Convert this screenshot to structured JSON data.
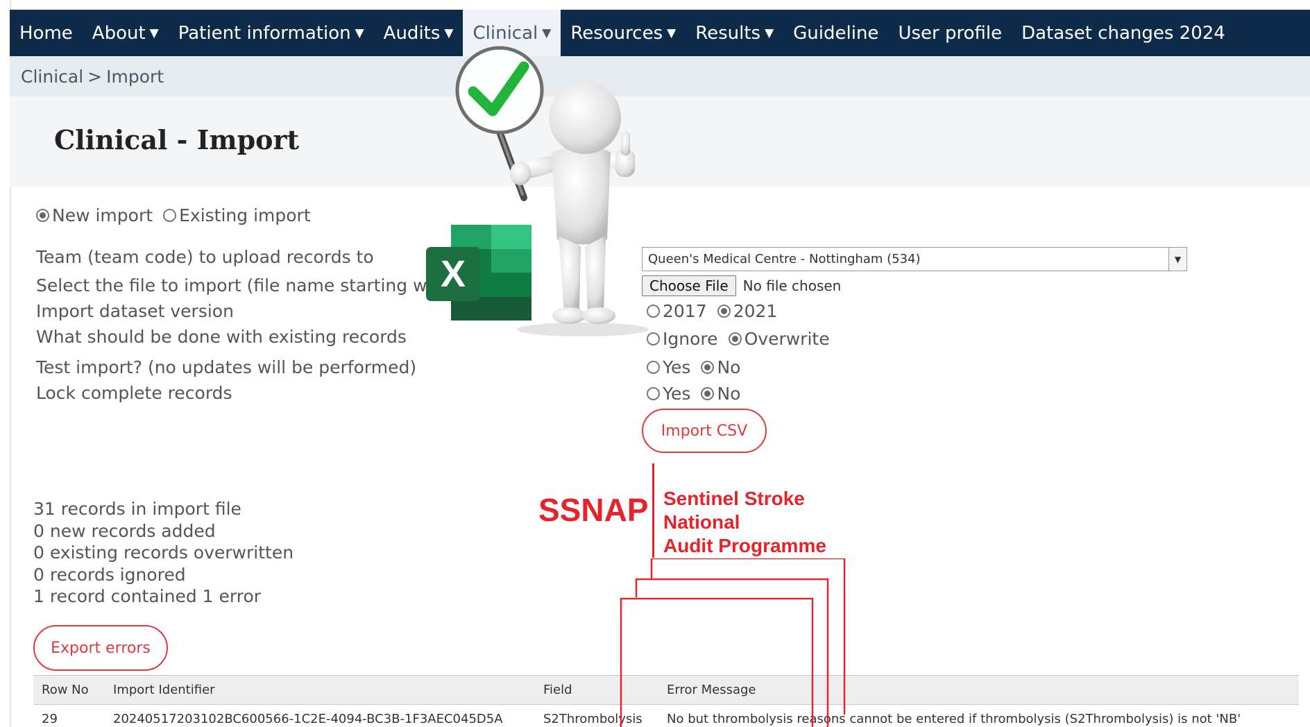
{
  "nav": {
    "items": [
      {
        "label": "Home",
        "dropdown": false
      },
      {
        "label": "About",
        "dropdown": true
      },
      {
        "label": "Patient information",
        "dropdown": true
      },
      {
        "label": "Audits",
        "dropdown": true
      },
      {
        "label": "Clinical",
        "dropdown": true,
        "active": true
      },
      {
        "label": "Resources",
        "dropdown": true
      },
      {
        "label": "Results",
        "dropdown": true
      },
      {
        "label": "Guideline",
        "dropdown": false
      },
      {
        "label": "User profile",
        "dropdown": false
      },
      {
        "label": "Dataset changes 2024",
        "dropdown": false
      }
    ],
    "caret": "▼"
  },
  "breadcrumb": {
    "parent": "Clinical",
    "separator": ">",
    "current": "Import"
  },
  "page": {
    "title": "Clinical - Import"
  },
  "mode": {
    "new_label": "New import",
    "existing_label": "Existing import",
    "selected": "New import"
  },
  "form": {
    "team_label": "Team (team code) to upload records to",
    "team_value": "Queen's Medical Centre - Nottingham (534)",
    "file_label": "Select the file to import (file name starting with t",
    "file_label_tail": ")",
    "file_button": "Choose File",
    "file_status": "No file chosen",
    "version_label": "Import dataset version",
    "version_options": [
      "2017",
      "2021"
    ],
    "version_selected": "2021",
    "existing_label": "What should be done with existing records",
    "existing_options": [
      "Ignore",
      "Overwrite"
    ],
    "existing_selected": "Overwrite",
    "test_label": "Test import? (no updates will be performed)",
    "test_options": [
      "Yes",
      "No"
    ],
    "test_selected": "No",
    "lock_label": "Lock complete records",
    "lock_options": [
      "Yes",
      "No"
    ],
    "lock_selected": "No",
    "import_button": "Import CSV"
  },
  "stats": [
    "31 records in import file",
    "0 new records added",
    "0 existing records overwritten",
    "0 records ignored",
    "1 record contained 1 error"
  ],
  "export_button": "Export errors",
  "errors_table": {
    "columns": [
      "Row No",
      "Import Identifier",
      "Field",
      "Error Message"
    ],
    "rows": [
      [
        "29",
        "20240517203102BC600566-1C2E-4094-BC3B-1F3AEC045D5A",
        "S2Thrombolysis",
        "No but thrombolysis reasons cannot be entered if thrombolysis (S2Thrombolysis) is not 'NB'"
      ]
    ]
  },
  "logo": {
    "acronym": "SSNAP",
    "line1": "Sentinel Stroke National",
    "line2": "Audit Programme",
    "color": "#e4232b"
  },
  "excel_icon": {
    "letter": "X",
    "icon": "excel-icon"
  },
  "colors": {
    "nav_bg": "#0f2b4a",
    "accent_red": "#e0393e",
    "excel_green": "#1d6f42",
    "check_green": "#22b33a"
  }
}
